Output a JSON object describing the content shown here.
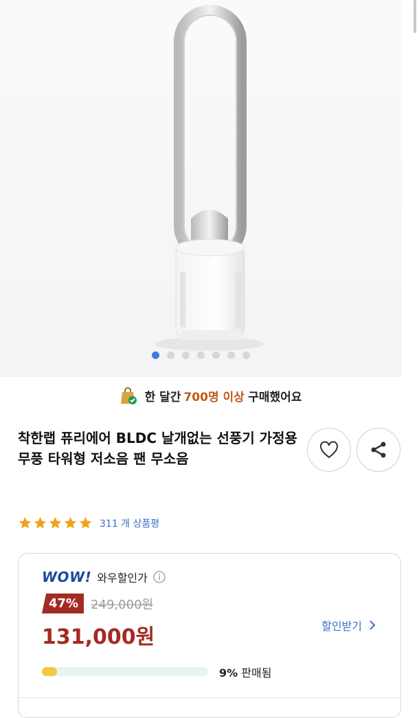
{
  "gallery": {
    "total_images": 7,
    "active_index": 0
  },
  "banner": {
    "highlight": "700명 이상",
    "prefix": "한 달간",
    "suffix": "구매했어요"
  },
  "product": {
    "title": "착한랩 퓨리에어 BLDC 날개없는 선풍기 가정용 무풍 타워형 저소음 팬 무소음",
    "rating": 5,
    "review_count": "311 개 상품평"
  },
  "price": {
    "wow_logo": "WOW!",
    "wow_label": "와우할인가",
    "discount_badge": "47%",
    "original_price": "249,000원",
    "sale_price": "131,000원",
    "coupon_label": "할인받기",
    "sold_percent_label": "9%",
    "sold_suffix": "판매됨",
    "sold_fraction": 0.09
  },
  "colors": {
    "accent": "#a42a24",
    "link": "#3a6fc4",
    "wow": "#1b4a9a",
    "progress": "#f4c93a"
  }
}
